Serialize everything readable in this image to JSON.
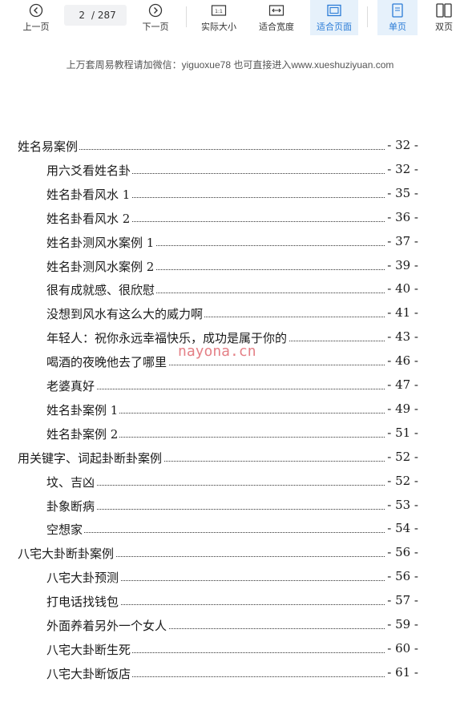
{
  "toolbar": {
    "prev_label": "上一页",
    "current_page": "2",
    "total_pages": "/ 287",
    "next_label": "下一页",
    "actual_size_label": "实际大小",
    "fit_width_label": "适合宽度",
    "fit_page_label": "适合页面",
    "single_page_label": "单页",
    "double_page_label": "双页",
    "accent_color": "#2a7bd6"
  },
  "page": {
    "header_note": "上万套周易教程请加微信：yiguoxue78  也可直接进入www.xueshuziyuan.com",
    "watermark": "nayona.cn"
  },
  "toc": [
    {
      "title": "姓名易案例",
      "page": "- 32 -",
      "level": 1
    },
    {
      "title": "用六爻看姓名卦",
      "page": "- 32 -",
      "level": 2
    },
    {
      "title": "姓名卦看风水 1",
      "page": "- 35 -",
      "level": 2
    },
    {
      "title": "姓名卦看风水 2",
      "page": "- 36 -",
      "level": 2
    },
    {
      "title": "姓名卦测风水案例 1",
      "page": "- 37 -",
      "level": 2
    },
    {
      "title": "姓名卦测风水案例 2",
      "page": "- 39 -",
      "level": 2
    },
    {
      "title": "很有成就感、很欣慰",
      "page": "- 40 -",
      "level": 2
    },
    {
      "title": "没想到风水有这么大的威力啊",
      "page": "- 41 -",
      "level": 2
    },
    {
      "title": "年轻人：祝你永远幸福快乐，成功是属于你的",
      "page": "- 43 -",
      "level": 2
    },
    {
      "title": "喝酒的夜晚他去了哪里",
      "page": "- 46 -",
      "level": 2
    },
    {
      "title": "老婆真好",
      "page": "- 47 -",
      "level": 2
    },
    {
      "title": "姓名卦案例 1",
      "page": "- 49 -",
      "level": 2
    },
    {
      "title": "姓名卦案例 2",
      "page": "- 51 -",
      "level": 2
    },
    {
      "title": "用关键字、词起卦断卦案例",
      "page": "- 52 -",
      "level": 1
    },
    {
      "title": "坟、吉凶",
      "page": "- 52 -",
      "level": 2
    },
    {
      "title": "卦象断病",
      "page": "- 53 -",
      "level": 2
    },
    {
      "title": "空想家",
      "page": "- 54 -",
      "level": 2
    },
    {
      "title": "八宅大卦断卦案例",
      "page": "- 56 -",
      "level": 1
    },
    {
      "title": "八宅大卦预测",
      "page": "- 56 -",
      "level": 2
    },
    {
      "title": "打电话找钱包",
      "page": "- 57 -",
      "level": 2
    },
    {
      "title": "外面养着另外一个女人",
      "page": "- 59 -",
      "level": 2
    },
    {
      "title": "八宅大卦断生死",
      "page": "- 60 -",
      "level": 2
    },
    {
      "title": "八宅大卦断饭店",
      "page": "- 61 -",
      "level": 2
    }
  ]
}
